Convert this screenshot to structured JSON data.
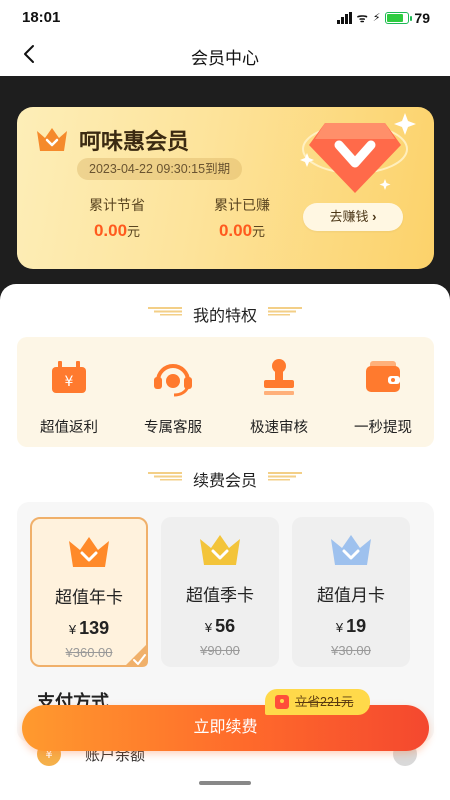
{
  "status_bar": {
    "time": "18:01",
    "battery": "79"
  },
  "nav": {
    "title": "会员中心"
  },
  "vip_card": {
    "name": "呵味惠会员",
    "expiry": "2023-04-22 09:30:15到期",
    "saved_label": "累计节省",
    "saved_value": "0.00",
    "earned_label": "累计已赚",
    "earned_value": "0.00",
    "unit": "元",
    "earn_button": "去赚钱"
  },
  "privileges": {
    "title": "我的特权",
    "items": [
      {
        "label": "超值返利",
        "icon": "rebate-icon"
      },
      {
        "label": "专属客服",
        "icon": "customer-service-icon"
      },
      {
        "label": "极速审核",
        "icon": "stamp-icon"
      },
      {
        "label": "一秒提现",
        "icon": "wallet-icon"
      }
    ]
  },
  "renew": {
    "title": "续费会员",
    "plans": [
      {
        "name": "超值年卡",
        "currency": "¥",
        "price": "139",
        "old_price": "¥360.00",
        "selected": true
      },
      {
        "name": "超值季卡",
        "currency": "¥",
        "price": "56",
        "old_price": "¥90.00",
        "selected": false
      },
      {
        "name": "超值月卡",
        "currency": "¥",
        "price": "19",
        "old_price": "¥30.00",
        "selected": false
      }
    ]
  },
  "payment": {
    "title": "支付方式",
    "method": "账户余额",
    "method_icon_text": "¥"
  },
  "action": {
    "button": "立即续费",
    "save_tag": "立省221元"
  },
  "colors": {
    "accent": "#ff6a2b",
    "price_highlight": "#ff5a1e",
    "card_gold": "#fcd26a"
  }
}
